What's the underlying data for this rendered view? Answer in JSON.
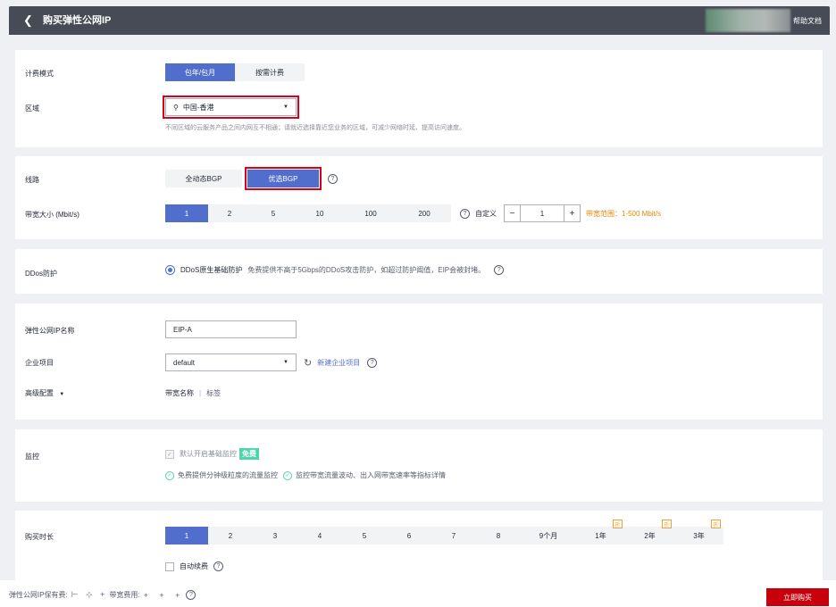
{
  "header": {
    "back_icon": "chevron-left-icon",
    "title": "购买弹性公网IP",
    "help": "帮助文档"
  },
  "billing": {
    "label": "计费模式",
    "options": [
      "包年/包月",
      "按需计费"
    ],
    "selected": "包年/包月"
  },
  "region": {
    "label": "区域",
    "value": "中国-香港",
    "icon": "location-pin-icon",
    "hint": "不同区域的云服务产品之间内网互不相通；请就近选择靠近您业务的区域，可减少网络时延、提高访问速度。"
  },
  "line": {
    "label": "线路",
    "options": [
      "全动态BGP",
      "优选BGP"
    ],
    "selected": "优选BGP"
  },
  "bandwidth": {
    "label": "带宽大小 (Mbit/s)",
    "options": [
      "1",
      "2",
      "5",
      "10",
      "100",
      "200"
    ],
    "selected": "1",
    "custom_label": "自定义",
    "stepper_value": "1",
    "minus": "−",
    "plus": "+",
    "range": "带宽范围：1-500 Mbit/s"
  },
  "ddos": {
    "label": "DDos防护",
    "option": "DDoS原生基础防护",
    "desc": "免费提供不高于5Gbps的DDoS攻击防护，如超过防护阈值，EIP会被封堵。"
  },
  "eip_name": {
    "label": "弹性公网IP名称",
    "value": "EIP-A"
  },
  "enterprise": {
    "label": "企业项目",
    "value": "default",
    "new_link": "新建企业项目"
  },
  "advanced": {
    "label": "高级配置",
    "options": [
      "带宽名称",
      "标签"
    ],
    "separator": "|"
  },
  "monitor": {
    "label": "监控",
    "checkbox_label": "默认开启基础监控",
    "free_tag": "免费",
    "notes": [
      "免费提供分钟级粒度的流量监控",
      "监控带宽流量波动、出入网带宽速率等指标详情"
    ]
  },
  "duration": {
    "label": "购买时长",
    "options": [
      "1",
      "2",
      "3",
      "4",
      "5",
      "6",
      "7",
      "8",
      "9个月",
      "1年",
      "2年",
      "3年"
    ],
    "selected": "1",
    "discount_badge": "折",
    "auto_renew": "自动续费"
  },
  "footer": {
    "fee_label": "弹性公网IP保有费:",
    "bandwidth_fee_label": "带宽费用:",
    "buy": "立即购买"
  },
  "colors": {
    "accent": "#526ecc",
    "danger": "#c7000b",
    "highlight": "#d9001b",
    "header_bg": "#474b55"
  }
}
